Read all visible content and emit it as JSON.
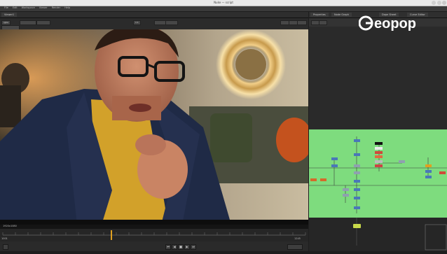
{
  "window": {
    "title": "Nuke — script"
  },
  "menu": {
    "items": [
      "File",
      "Edit",
      "Workspace",
      "Viewer",
      "Render",
      "Help"
    ]
  },
  "viewer": {
    "tabs": [
      "Viewer1"
    ],
    "channels": "rgba",
    "zoom": "1:1",
    "frame_info": "1920x1080",
    "timeline_start": "1001",
    "timeline_end": "1245"
  },
  "right_panel": {
    "tabs": [
      "Properties",
      "Node Graph",
      "Dope Sheet",
      "Curve Editor"
    ]
  },
  "watermark": {
    "logo_text": "Geopop"
  },
  "colors": {
    "graph_bg": "#7edc7e",
    "playhead": "#e0a020",
    "accent": "#e0a020"
  },
  "icons": {
    "play": "▶",
    "rewind": "◀",
    "stop": "■",
    "first": "⏮",
    "last": "⏭"
  }
}
